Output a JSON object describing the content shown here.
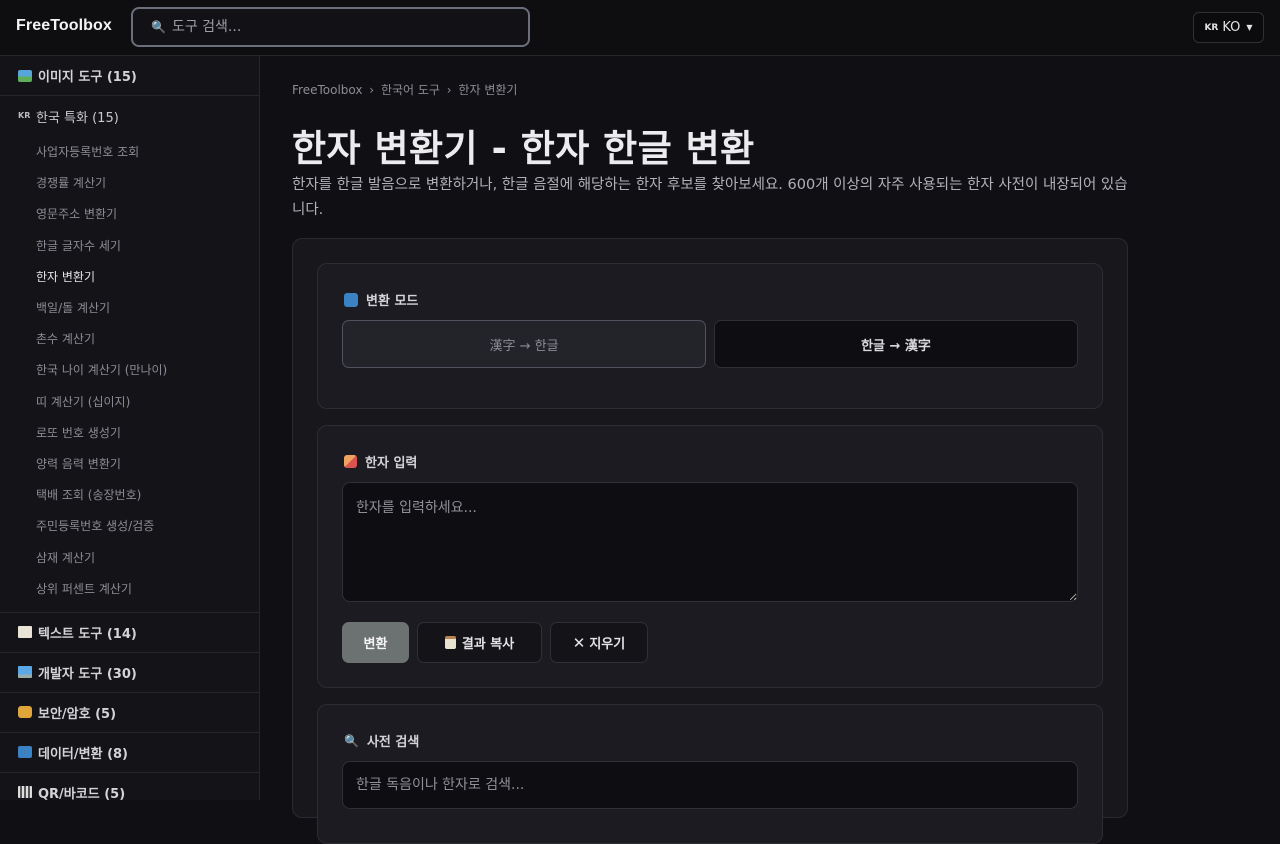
{
  "header": {
    "logo": "FreeToolbox",
    "search_placeholder": "도구 검색...",
    "lang_flag": "KR",
    "lang_code": "KO"
  },
  "sidebar": {
    "categories_top": [
      {
        "icon": "image-icon",
        "label": "이미지 도구 (15)"
      }
    ],
    "open_category": {
      "flag": "KR",
      "label": "한국 특화 (15)"
    },
    "subitems": [
      "사업자등록번호 조회",
      "경쟁률 계산기",
      "영문주소 변환기",
      "한글 글자수 세기",
      "한자 변환기",
      "백일/돌 계산기",
      "촌수 계산기",
      "한국 나이 계산기 (만나이)",
      "띠 계산기 (십이지)",
      "로또 번호 생성기",
      "양력 음력 변환기",
      "택배 조회 (송장번호)",
      "주민등록번호 생성/검증",
      "삼재 계산기",
      "상위 퍼센트 계산기"
    ],
    "active_index": 4,
    "categories_bottom": [
      {
        "icon": "document-icon",
        "label": "텍스트 도구 (14)"
      },
      {
        "icon": "laptop-icon",
        "label": "개발자 도구 (30)"
      },
      {
        "icon": "lock-icon",
        "label": "보안/암호 (5)"
      },
      {
        "icon": "refresh-icon",
        "label": "데이터/변환 (8)"
      },
      {
        "icon": "qr-icon",
        "label": "QR/바코드 (5)"
      }
    ]
  },
  "breadcrumb": {
    "home": "FreeToolbox",
    "section": "한국어 도구",
    "current": "한자 변환기",
    "sep": "›"
  },
  "page": {
    "title": "한자 변환기 - 한자 한글 변환",
    "description": "한자를 한글 발음으로 변환하거나, 한글 음절에 해당하는 한자 후보를 찾아보세요. 600개 이상의 자주 사용되는 한자 사전이 내장되어 있습니다."
  },
  "mode": {
    "label": "변환 모드",
    "option_a": "漢字 → 한글",
    "option_b": "한글 → 漢字"
  },
  "input": {
    "label": "한자 입력",
    "placeholder": "한자를 입력하세요...",
    "convert": "변환",
    "copy": "결과 복사",
    "clear": "지우기"
  },
  "dict": {
    "label": "사전 검색",
    "placeholder": "한글 독음이나 한자로 검색..."
  },
  "colors": {
    "accent_convert": "#6b7271",
    "background": "#101014"
  }
}
